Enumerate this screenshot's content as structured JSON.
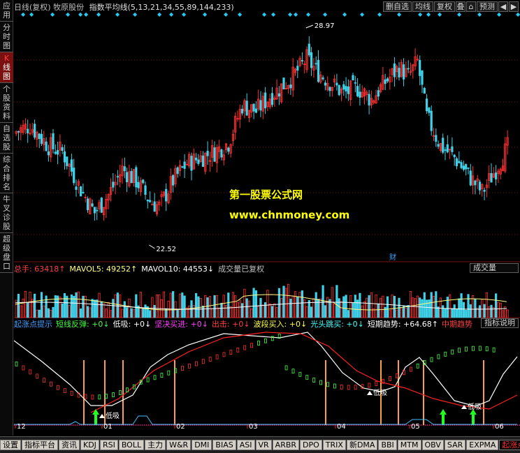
{
  "sidenav": [
    {
      "label": "应用",
      "active": false
    },
    {
      "label": "分时图",
      "active": false
    },
    {
      "label": "K线图",
      "active": true
    },
    {
      "label": "个股资料",
      "active": false
    },
    {
      "label": "自选股",
      "active": false
    },
    {
      "label": "综合排名",
      "active": false
    },
    {
      "label": "牛叉诊股",
      "active": false
    },
    {
      "label": "超级盘口",
      "active": false
    }
  ],
  "header": {
    "title": "日线(复权)  牧原股份",
    "indicator": "指数平均线(5,13,21,34,55,89,144,233)"
  },
  "toolbar": [
    "删自选",
    "均线",
    "复权",
    "叠",
    "⌂",
    "预测",
    "◀",
    "▶"
  ],
  "price": {
    "high_label": "28.97",
    "low_label": "22.52",
    "flag": "财"
  },
  "watermark": {
    "line1": "第一股票公式网",
    "line2": "www.chnmoney.com"
  },
  "volume": {
    "items": [
      {
        "text": "总手: 63418↑",
        "color": "#ff4040"
      },
      {
        "text": "MAVOL5: 49252↑",
        "color": "#ffff80"
      },
      {
        "text": "MAVOL10: 44553↓",
        "color": "#ffffff"
      },
      {
        "text": "成交量已复权",
        "color": "#c0c0c0"
      }
    ],
    "button": "成交量"
  },
  "indicator": {
    "items": [
      {
        "text": "起涨点提示",
        "color": "#40a0ff"
      },
      {
        "text": "短线反弹: +0↓",
        "color": "#40ff40"
      },
      {
        "text": "低吸: +0↓",
        "color": "#ffffff"
      },
      {
        "text": "坚决买进: +0↓",
        "color": "#ff40ff"
      },
      {
        "text": "出击: +0↓",
        "color": "#ff4040"
      },
      {
        "text": "波段买入: +0↓",
        "color": "#ffff40"
      },
      {
        "text": "光头跳买: +0↓",
        "color": "#40ffff"
      },
      {
        "text": "短期趋势: +64.68↑",
        "color": "#ffffff"
      },
      {
        "text": "中期趋势",
        "color": "#ff4040"
      }
    ],
    "button": "指标说明",
    "labels": [
      "低吸",
      "低吸",
      "低吸"
    ]
  },
  "x_axis": [
    "12",
    "01",
    "02",
    "03",
    "04",
    "05",
    "06"
  ],
  "tabs": [
    {
      "label": "设置",
      "active": false
    },
    {
      "label": "指标平台",
      "active": false
    },
    {
      "label": "资讯",
      "active": false
    },
    {
      "label": "KDJ",
      "active": false
    },
    {
      "label": "RSI",
      "active": false
    },
    {
      "label": "BOLL",
      "active": false
    },
    {
      "label": "主力",
      "active": false
    },
    {
      "label": "W&R",
      "active": false
    },
    {
      "label": "DMI",
      "active": false
    },
    {
      "label": "BIAS",
      "active": false
    },
    {
      "label": "ASI",
      "active": false
    },
    {
      "label": "VR",
      "active": false
    },
    {
      "label": "ARBR",
      "active": false
    },
    {
      "label": "DPO",
      "active": false
    },
    {
      "label": "TRIX",
      "active": false
    },
    {
      "label": "新DMA",
      "active": false
    },
    {
      "label": "BBI",
      "active": false
    },
    {
      "label": "MTM",
      "active": false
    },
    {
      "label": "OBV",
      "active": false
    },
    {
      "label": "SAR",
      "active": false
    },
    {
      "label": "EXPMA",
      "active": false
    },
    {
      "label": "起涨点提示",
      "active": true
    }
  ],
  "colors": {
    "up": "#ff3030",
    "down": "#40d0e8",
    "grid": "#7a1010"
  }
}
